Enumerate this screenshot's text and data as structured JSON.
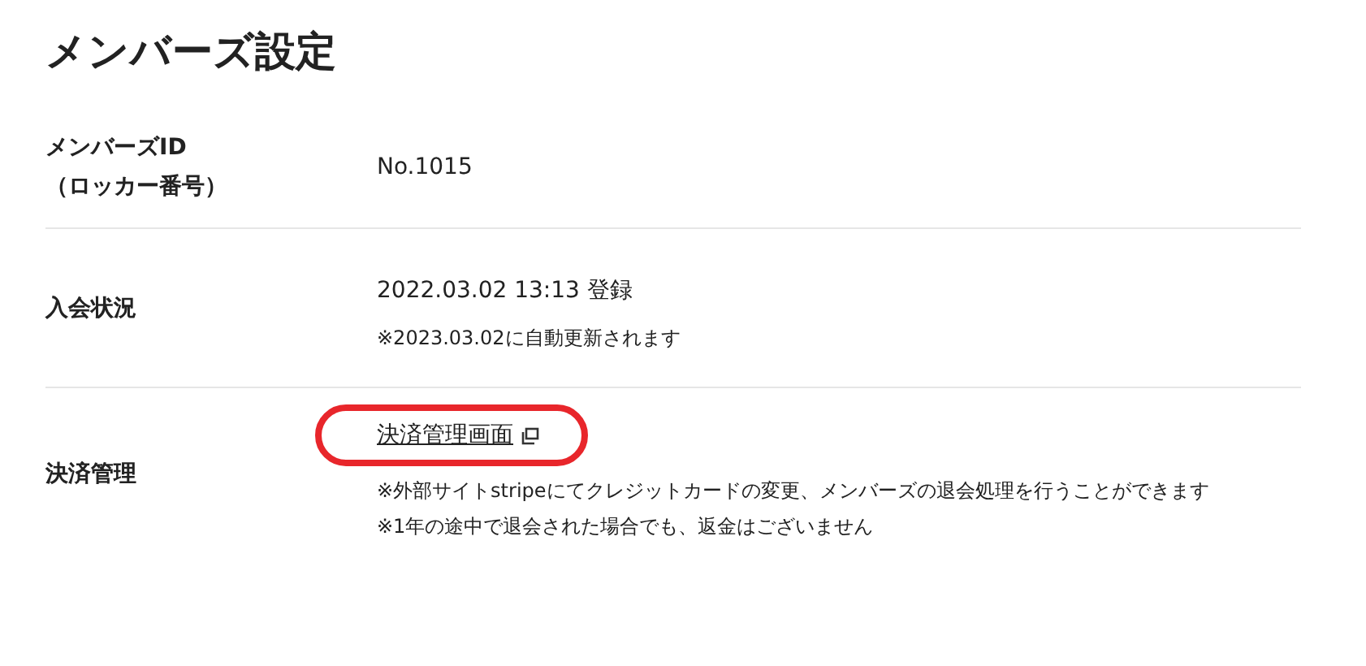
{
  "title": "メンバーズ設定",
  "rows": [
    {
      "label_lines": [
        "メンバーズID",
        "（ロッカー番号）"
      ],
      "kind": "text",
      "value": "No.1015"
    },
    {
      "label_lines": [
        "入会状況"
      ],
      "kind": "status",
      "value": "2022.03.02 13:13 登録",
      "notes": [
        "※2023.03.02に自動更新されます"
      ]
    },
    {
      "label_lines": [
        "決済管理"
      ],
      "kind": "link",
      "value": "決済管理画面",
      "highlighted": true,
      "notes": [
        "※外部サイトstripeにてクレジットカードの変更、メンバーズの退会処理を行うことができます",
        "※1年の途中で退会された場合でも、返金はございません"
      ]
    }
  ]
}
